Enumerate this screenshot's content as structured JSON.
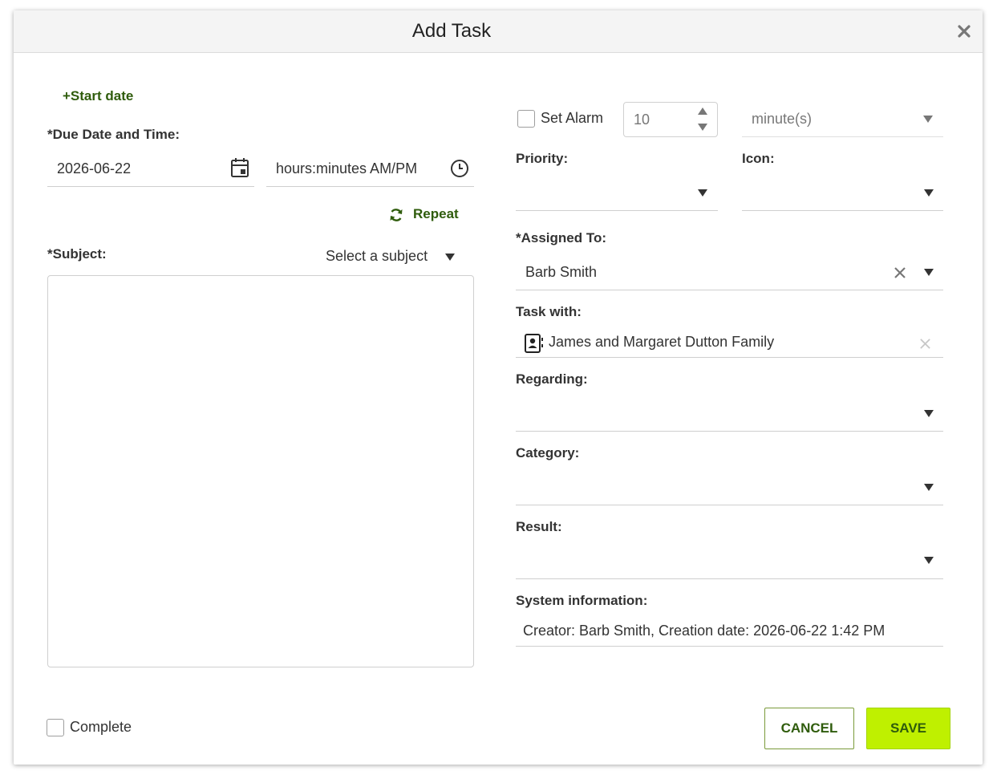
{
  "dialog": {
    "title": "Add Task"
  },
  "left": {
    "start_date_link": "+Start date",
    "due_label": "*Due Date and Time:",
    "due_date_value": "2026-06-22",
    "time_placeholder": "hours:minutes AM/PM",
    "repeat_label": "Repeat",
    "subject_label": "*Subject:",
    "subject_select": "Select a subject",
    "complete_label": "Complete"
  },
  "right": {
    "alarm_label": "Set Alarm",
    "alarm_value": "10",
    "alarm_unit": "minute(s)",
    "priority_label": "Priority:",
    "icon_label": "Icon:",
    "assigned_label": "*Assigned To:",
    "assigned_value": "Barb Smith",
    "task_with_label": "Task with:",
    "task_with_value": "James and Margaret Dutton Family",
    "regarding_label": "Regarding:",
    "category_label": "Category:",
    "result_label": "Result:",
    "system_label": "System information:",
    "system_value": "Creator: Barb Smith, Creation date: 2026-06-22 1:42 PM"
  },
  "buttons": {
    "cancel": "CANCEL",
    "save": "SAVE"
  },
  "icons": {
    "close": "close-icon",
    "calendar": "calendar-icon",
    "clock": "clock-icon",
    "repeat": "repeat-icon",
    "contact": "contact-card-icon"
  },
  "colors": {
    "accent_green": "#2f5c0c",
    "save_bg": "#bff000",
    "title_bar_bg": "#f4f4f4"
  }
}
